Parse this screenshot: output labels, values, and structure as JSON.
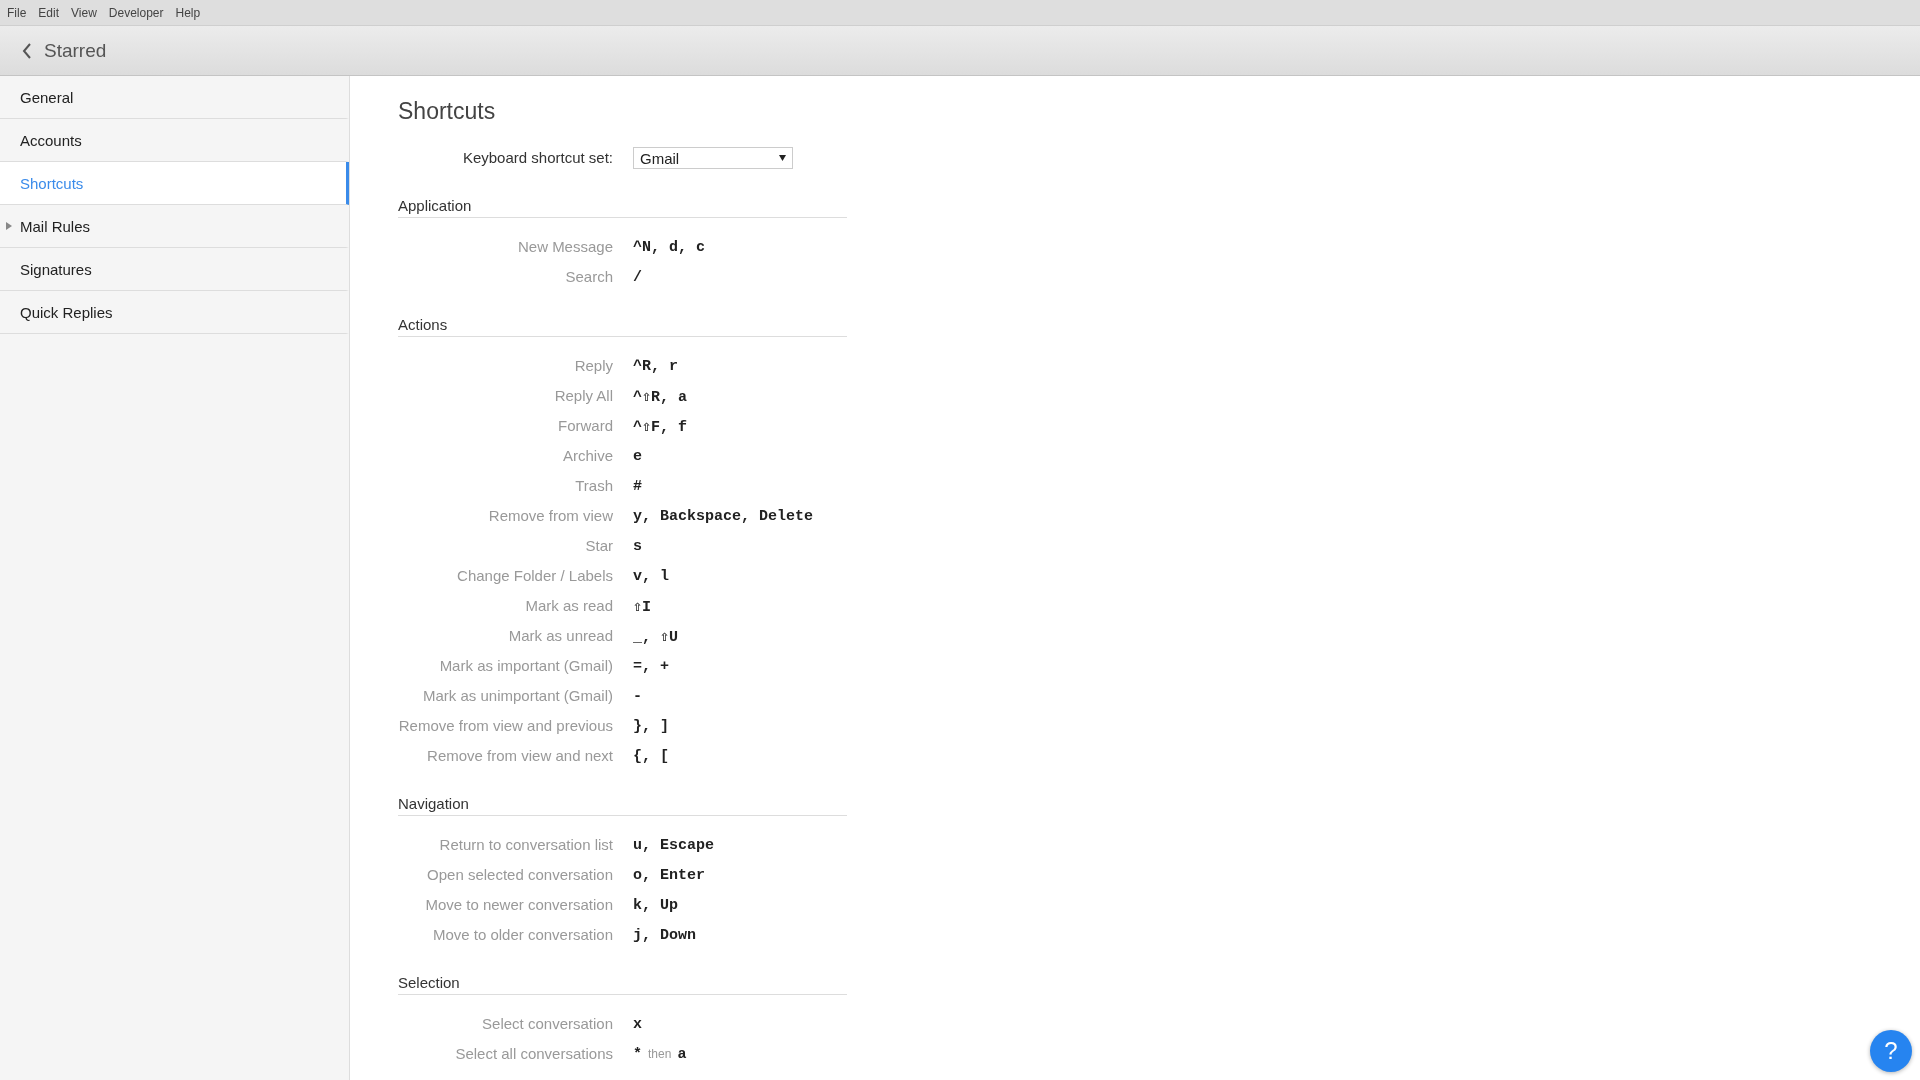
{
  "menu_bar": [
    "File",
    "Edit",
    "View",
    "Developer",
    "Help"
  ],
  "header": {
    "title": "Starred"
  },
  "sidebar": {
    "items": [
      {
        "label": "General",
        "selected": false
      },
      {
        "label": "Accounts",
        "selected": false
      },
      {
        "label": "Shortcuts",
        "selected": true
      },
      {
        "label": "Mail Rules",
        "selected": false,
        "expandable": true
      },
      {
        "label": "Signatures",
        "selected": false
      },
      {
        "label": "Quick Replies",
        "selected": false
      }
    ]
  },
  "page": {
    "title": "Shortcuts",
    "shortcut_set": {
      "label": "Keyboard shortcut set:",
      "value": "Gmail"
    },
    "sections": [
      {
        "title": "Application",
        "shortcuts": [
          {
            "action": "New Message",
            "keys": "^N, d, c"
          },
          {
            "action": "Search",
            "keys": "/"
          }
        ]
      },
      {
        "title": "Actions",
        "shortcuts": [
          {
            "action": "Reply",
            "keys": "^R, r"
          },
          {
            "action": "Reply All",
            "keys": "^⇧R, a"
          },
          {
            "action": "Forward",
            "keys": "^⇧F, f"
          },
          {
            "action": "Archive",
            "keys": "e"
          },
          {
            "action": "Trash",
            "keys": "#"
          },
          {
            "action": "Remove from view",
            "keys": "y, Backspace, Delete"
          },
          {
            "action": "Star",
            "keys": "s"
          },
          {
            "action": "Change Folder / Labels",
            "keys": "v, l"
          },
          {
            "action": "Mark as read",
            "keys": "⇧I"
          },
          {
            "action": "Mark as unread",
            "keys": "_, ⇧U"
          },
          {
            "action": "Mark as important (Gmail)",
            "keys": "=, +"
          },
          {
            "action": "Mark as unimportant (Gmail)",
            "keys": "-"
          },
          {
            "action": "Remove from view and previous",
            "keys": "}, ]"
          },
          {
            "action": "Remove from view and next",
            "keys": "{, ["
          }
        ]
      },
      {
        "title": "Navigation",
        "shortcuts": [
          {
            "action": "Return to conversation list",
            "keys": "u, Escape"
          },
          {
            "action": "Open selected conversation",
            "keys": "o, Enter"
          },
          {
            "action": "Move to newer conversation",
            "keys": "k, Up"
          },
          {
            "action": "Move to older conversation",
            "keys": "j, Down"
          }
        ]
      },
      {
        "title": "Selection",
        "shortcuts": [
          {
            "action": "Select conversation",
            "keys": "x"
          },
          {
            "action": "Select all conversations",
            "keys": "*",
            "joiner": "then",
            "keys_after": "a"
          }
        ]
      }
    ]
  },
  "help_button": {
    "label": "?"
  }
}
